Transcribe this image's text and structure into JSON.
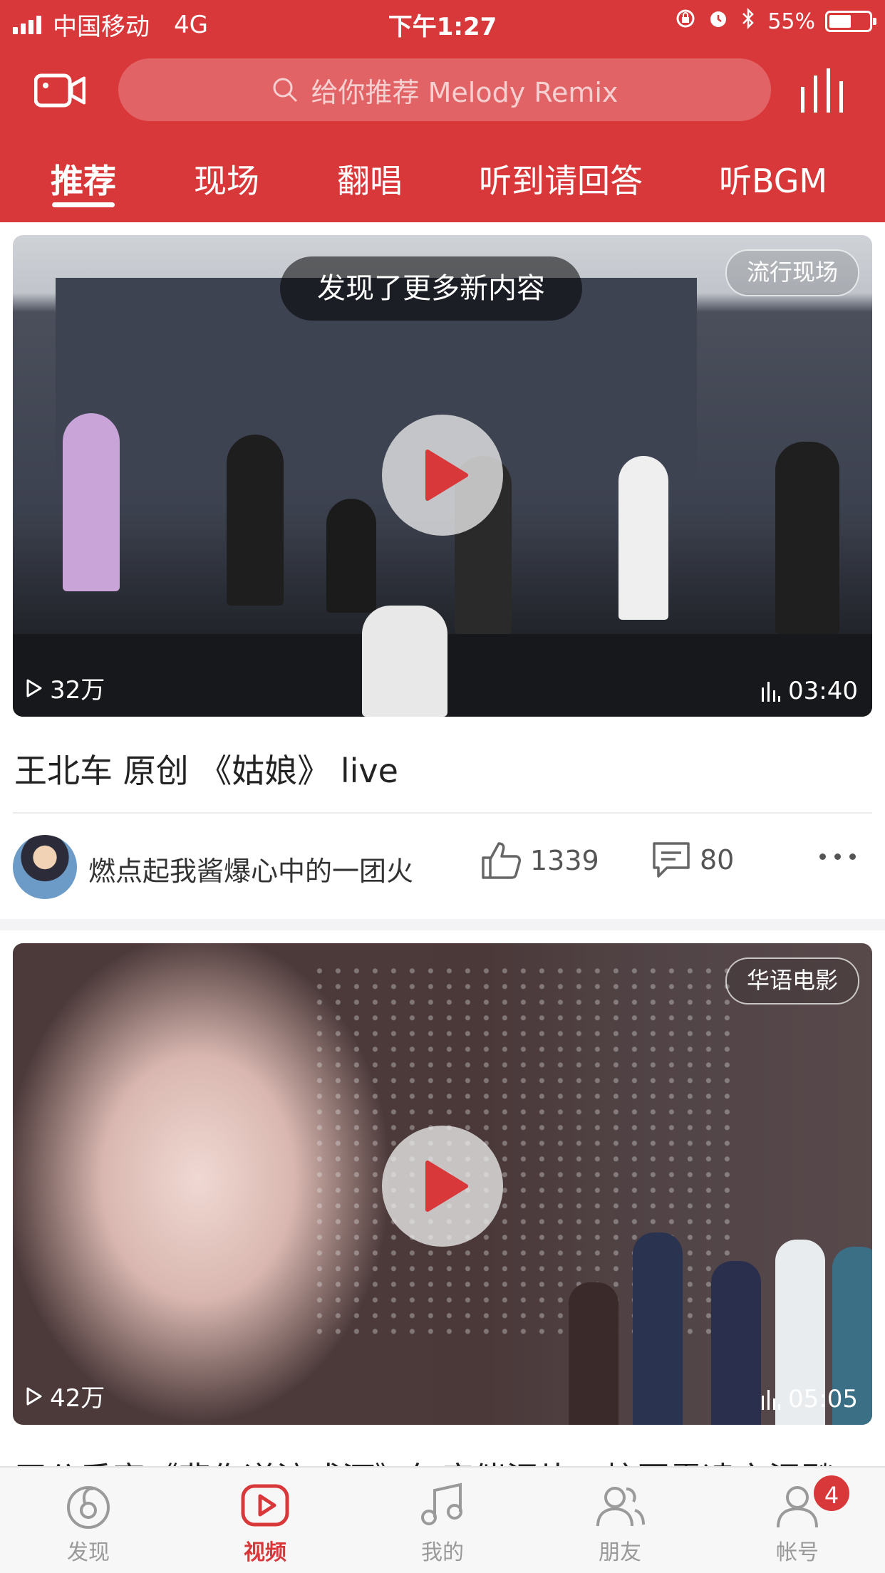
{
  "status_bar": {
    "carrier": "中国移动",
    "network": "4G",
    "time": "下午1:27",
    "battery": "55%",
    "battery_level": 0.55,
    "icons": [
      "lock-rotation-icon",
      "alarm-icon",
      "bluetooth-icon"
    ]
  },
  "header": {
    "left_icon": "video-camera-icon",
    "search_placeholder": "给你推荐 Melody Remix",
    "right_icon": "equalizer-icon"
  },
  "tabs": [
    {
      "label": "推荐",
      "active": true
    },
    {
      "label": "现场",
      "active": false
    },
    {
      "label": "翻唱",
      "active": false
    },
    {
      "label": "听到请回答",
      "active": false
    },
    {
      "label": "听BGM",
      "active": false
    }
  ],
  "notice": "发现了更多新内容",
  "videos": [
    {
      "tag": "流行现场",
      "views": "32万",
      "duration": "03:40",
      "title": "王北车 原创 《姑娘》 live",
      "author": "燃点起我酱爆心中的一团火",
      "likes": "1339",
      "comments": "80"
    },
    {
      "tag": "华语电影",
      "views": "42万",
      "duration": "05:05",
      "title": "王公乘客《悲伤逆流成河》年度催泪片，校园霸凌之泪飚"
    }
  ],
  "bottom_nav": [
    {
      "label": "发现",
      "icon": "discover-icon",
      "active": false
    },
    {
      "label": "视频",
      "icon": "video-play-icon",
      "active": true
    },
    {
      "label": "我的",
      "icon": "music-note-icon",
      "active": false
    },
    {
      "label": "朋友",
      "icon": "friends-icon",
      "active": false
    },
    {
      "label": "帐号",
      "icon": "account-icon",
      "active": false,
      "badge": "4"
    }
  ],
  "colors": {
    "brand": "#d9383a",
    "inactive": "#9a9a9a"
  }
}
